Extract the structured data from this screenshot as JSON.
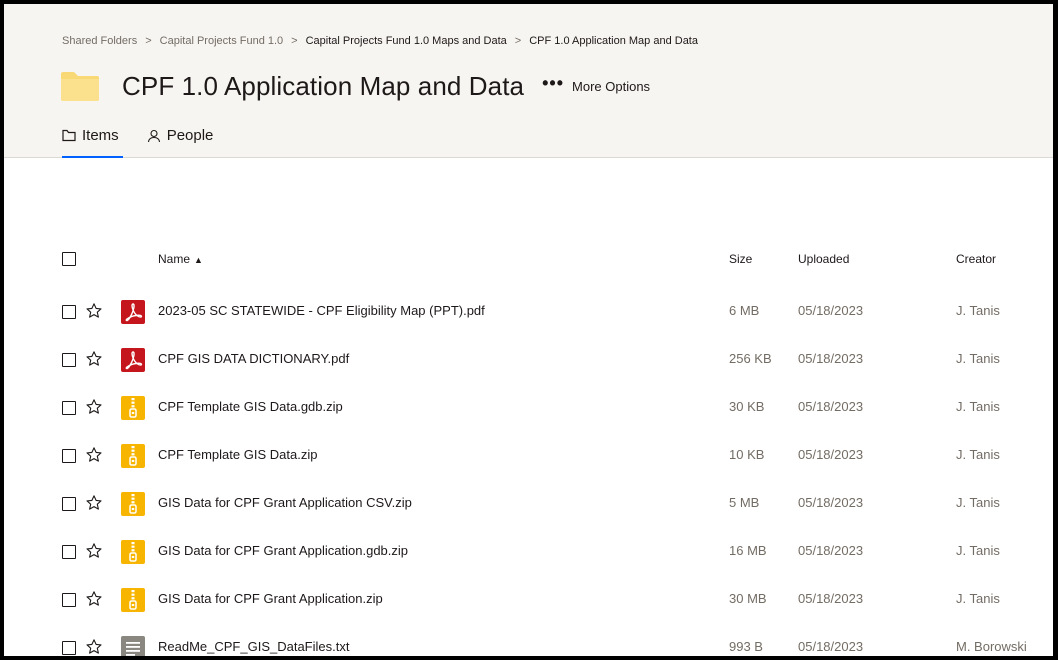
{
  "breadcrumb": {
    "items": [
      "Shared Folders",
      "Capital Projects Fund 1.0",
      "Capital Projects Fund 1.0 Maps and Data",
      "CPF 1.0 Application Map and Data"
    ],
    "separator": ">"
  },
  "header": {
    "title": "CPF 1.0 Application Map and Data",
    "more_dots": "•••",
    "more_label": "More Options"
  },
  "tabs": [
    {
      "label": "Items",
      "active": true
    },
    {
      "label": "People",
      "active": false
    }
  ],
  "table": {
    "columns": {
      "name": "Name",
      "sort_arrow": "▲",
      "size": "Size",
      "uploaded": "Uploaded",
      "creator": "Creator"
    },
    "rows": [
      {
        "name": "2023-05 SC STATEWIDE - CPF Eligibility Map (PPT).pdf",
        "type": "pdf",
        "size": "6 MB",
        "uploaded": "05/18/2023",
        "creator": "J. Tanis"
      },
      {
        "name": "CPF GIS DATA DICTIONARY.pdf",
        "type": "pdf",
        "size": "256 KB",
        "uploaded": "05/18/2023",
        "creator": "J. Tanis"
      },
      {
        "name": "CPF Template GIS Data.gdb.zip",
        "type": "zip",
        "size": "30 KB",
        "uploaded": "05/18/2023",
        "creator": "J. Tanis"
      },
      {
        "name": "CPF Template GIS Data.zip",
        "type": "zip",
        "size": "10 KB",
        "uploaded": "05/18/2023",
        "creator": "J. Tanis"
      },
      {
        "name": "GIS Data for CPF Grant Application CSV.zip",
        "type": "zip",
        "size": "5 MB",
        "uploaded": "05/18/2023",
        "creator": "J. Tanis"
      },
      {
        "name": "GIS Data for CPF Grant Application.gdb.zip",
        "type": "zip",
        "size": "16 MB",
        "uploaded": "05/18/2023",
        "creator": "J. Tanis"
      },
      {
        "name": "GIS Data for CPF Grant Application.zip",
        "type": "zip",
        "size": "30 MB",
        "uploaded": "05/18/2023",
        "creator": "J. Tanis"
      },
      {
        "name": "ReadMe_CPF_GIS_DataFiles.txt",
        "type": "txt",
        "size": "993 B",
        "uploaded": "05/18/2023",
        "creator": "M. Borowski"
      }
    ]
  },
  "colors": {
    "pdf_icon": "#c4161c",
    "zip_icon": "#f7b500",
    "txt_icon": "#8a8680",
    "folder": "#f9d976",
    "accent": "#0061fe"
  }
}
